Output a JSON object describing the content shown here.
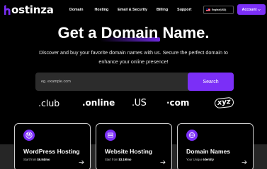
{
  "brand": {
    "logo_text": "ostinza",
    "icon": "h-logo-mark",
    "accent": "#7b2ff7"
  },
  "nav": {
    "items": [
      {
        "label": "Domain"
      },
      {
        "label": "Hosting"
      },
      {
        "label": "Email & Security"
      },
      {
        "label": "Billing"
      },
      {
        "label": "Support"
      }
    ],
    "language_label": "English(USD)",
    "account_label": "Account"
  },
  "hero": {
    "title_before": "Get a ",
    "title_highlight": "Domain",
    "title_after": " Name.",
    "subtitle_line1": "Discover and buy your favorite domain names with us. Secure the perfect domain to",
    "subtitle_line2": "enhance your online presence!"
  },
  "search": {
    "placeholder": "eg. example.com",
    "button_label": "Search"
  },
  "tlds": [
    ".club",
    ".online",
    ".US",
    "·com",
    "xyz"
  ],
  "cards": [
    {
      "title": "WordPress Hosting",
      "sub_prefix": "Start from ",
      "sub_value": "$6.94/mo",
      "icon": "wordpress-icon"
    },
    {
      "title": "Website Hosting",
      "sub_prefix": "Start from ",
      "sub_value": "$3.19/mo",
      "icon": "server-icon"
    },
    {
      "title": "Domain Names",
      "sub_prefix": "Your Unique ",
      "sub_value": "Identity",
      "icon": "globe-icon"
    }
  ]
}
